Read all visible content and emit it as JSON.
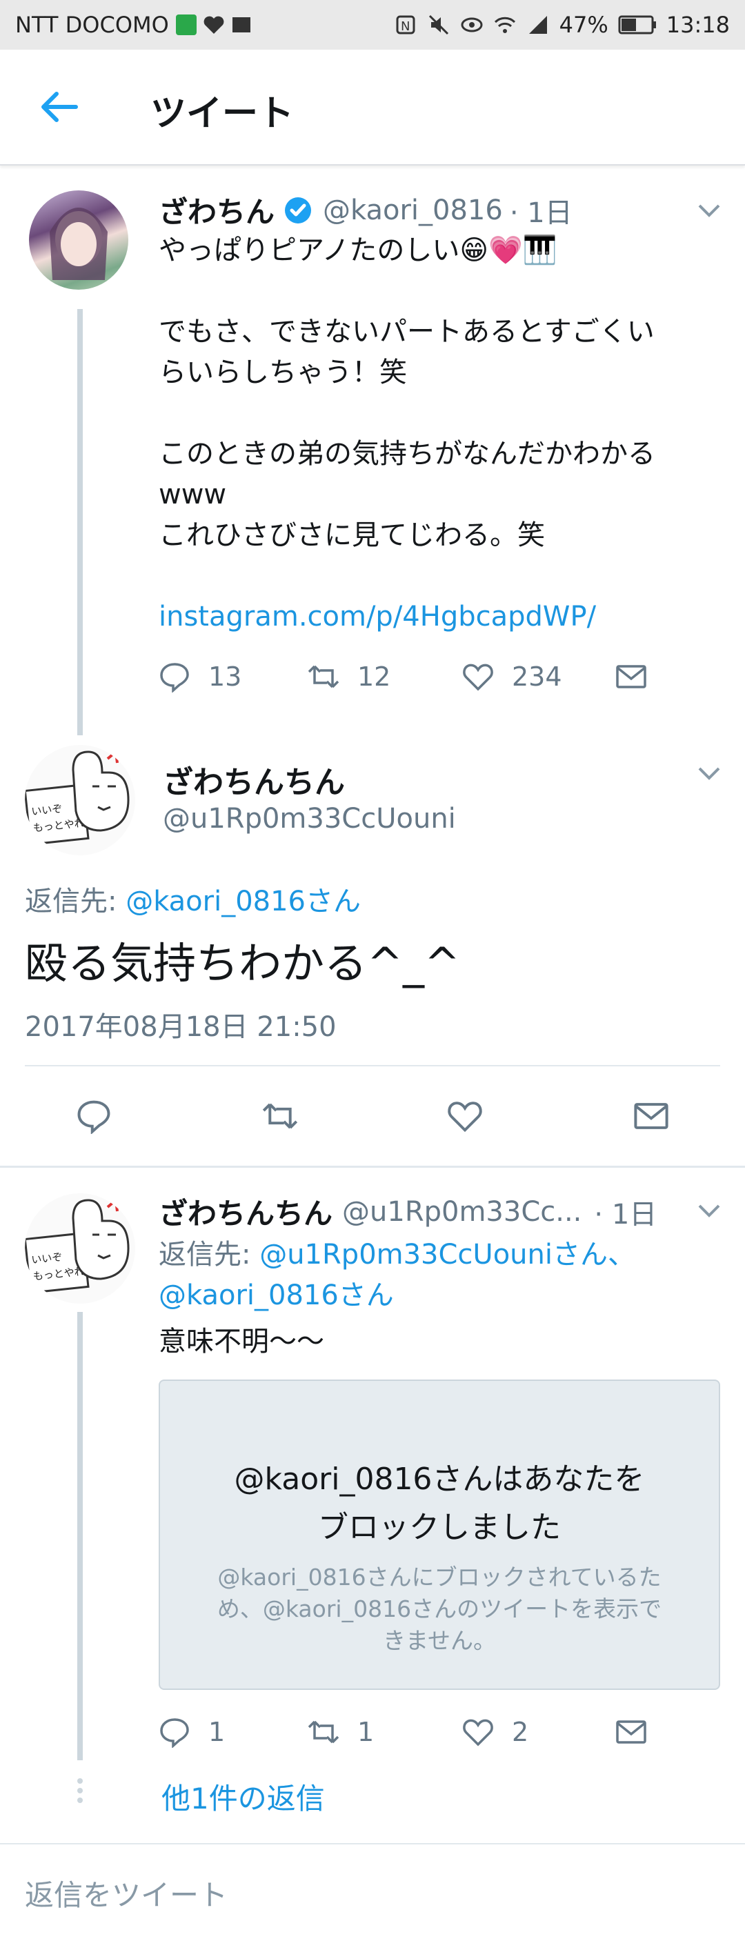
{
  "status_bar": {
    "carrier": "NTT DOCOMO",
    "battery": "47%",
    "time": "13:18"
  },
  "app_bar": {
    "title": "ツイート"
  },
  "tweet1": {
    "name": "ざわちん",
    "handle": "@kaori_0816",
    "time": "· 1日",
    "lines": [
      "やっぱりピアノたのしい😁💗🎹",
      "",
      "でもさ、できないパートあるとすごくい",
      "らいらしちゃう！笑",
      "",
      "このときの弟の気持ちがなんだかわかる",
      "www",
      "これひさびさに見てじわる。笑"
    ],
    "link": "instagram.com/p/4HgbcapdWP/",
    "replies": "13",
    "retweets": "12",
    "likes": "234"
  },
  "main_tweet": {
    "name": "ざわちんちん",
    "handle": "@u1Rp0m33CcUouni",
    "reply_prefix": "返信先: ",
    "reply_to": "@kaori_0816さん",
    "text": "殴る気持ちわかる^_^",
    "timestamp": "2017年08月18日 21:50"
  },
  "tweet3": {
    "name": "ざわちんちん",
    "handle": "@u1Rp0m33Cc...",
    "time": "· 1日",
    "reply_prefix": "返信先: ",
    "reply_to_1": "@u1Rp0m33CcUouniさん、",
    "reply_to_2": "@kaori_0816さん",
    "text": "意味不明〜〜",
    "blocked_title_1": "@kaori_0816さんはあなたを",
    "blocked_title_2": "ブロックしました",
    "blocked_desc_1": "@kaori_0816さんにブロックされているた",
    "blocked_desc_2": "め、@kaori_0816さんのツイートを表示で",
    "blocked_desc_3": "きません。",
    "replies": "1",
    "retweets": "1",
    "likes": "2",
    "more_replies": "他1件の返信"
  },
  "reply_bar": {
    "placeholder": "返信をツイート"
  },
  "colors": {
    "link": "#1b95e0",
    "verified": "#1da1f2",
    "icon_gray": "#657786"
  }
}
